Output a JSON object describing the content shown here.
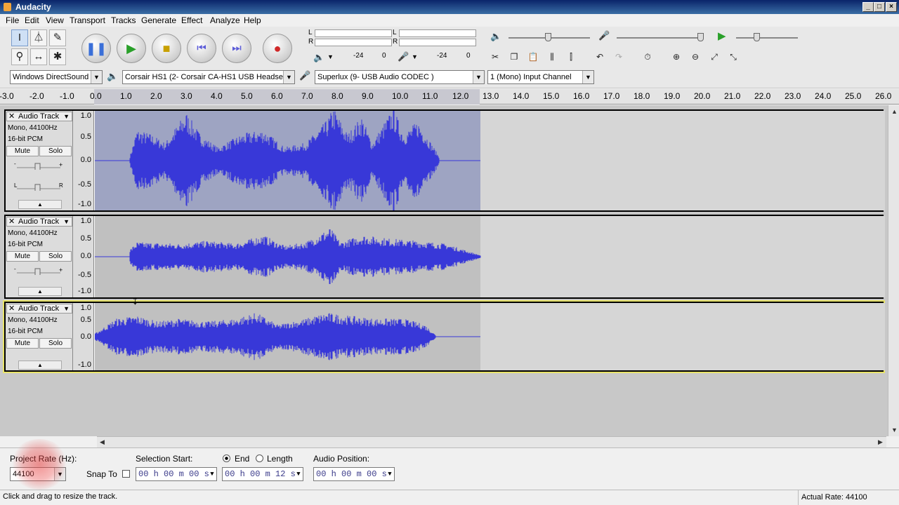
{
  "window": {
    "title": "Audacity"
  },
  "menu": [
    "File",
    "Edit",
    "View",
    "Transport",
    "Tracks",
    "Generate",
    "Effect",
    "Analyze",
    "Help"
  ],
  "meters": {
    "record_labels": [
      "-24",
      "0"
    ],
    "play_labels": [
      "-24",
      "0"
    ],
    "channel_l": "L",
    "channel_r": "R"
  },
  "devices": {
    "host": "Windows DirectSound",
    "playback": "Corsair HS1 (2- Corsair CA-HS1 USB Headset)",
    "recording": "Superlux (9- USB Audio CODEC )",
    "channels": "1 (Mono) Input Channel"
  },
  "ruler": {
    "ticks": [
      "-3.0",
      "-2.0",
      "-1.0",
      "0.0",
      "1.0",
      "2.0",
      "3.0",
      "4.0",
      "5.0",
      "6.0",
      "7.0",
      "8.0",
      "9.0",
      "10.0",
      "11.0",
      "12.0",
      "13.0",
      "14.0",
      "15.0",
      "16.0",
      "17.0",
      "18.0",
      "19.0",
      "20.0",
      "21.0",
      "22.0",
      "23.0",
      "24.0",
      "25.0",
      "26.0"
    ]
  },
  "tracks": [
    {
      "name": "Audio Track",
      "format": "Mono, 44100Hz",
      "bits": "16-bit PCM",
      "mute": "Mute",
      "solo": "Solo",
      "scale": [
        "1.0",
        "0.5",
        "0.0",
        "-0.5",
        "-1.0"
      ],
      "selected": true
    },
    {
      "name": "Audio Track",
      "format": "Mono, 44100Hz",
      "bits": "16-bit PCM",
      "mute": "Mute",
      "solo": "Solo",
      "scale": [
        "1.0",
        "0.5",
        "0.0",
        "-0.5",
        "-1.0"
      ],
      "selected": false
    },
    {
      "name": "Audio Track",
      "format": "Mono, 44100Hz",
      "bits": "16-bit PCM",
      "mute": "Mute",
      "solo": "Solo",
      "scale": [
        "1.0",
        "0.5",
        "0.0",
        "-1.0"
      ],
      "selected": false
    }
  ],
  "selection_bar": {
    "project_rate_label": "Project Rate (Hz):",
    "project_rate": "44100",
    "snap_to": "Snap To",
    "selection_start_label": "Selection Start:",
    "end_label": "End",
    "length_label": "Length",
    "audio_position_label": "Audio Position:",
    "start_value": "00 h 00 m 00 s",
    "end_value": "00 h 00 m 12 s",
    "position_value": "00 h 00 m 00 s"
  },
  "status": {
    "message": "Click and drag to resize the track.",
    "actual_rate": "Actual Rate: 44100"
  },
  "colors": {
    "wave": "#3838d8",
    "selection": "#9ea4c2",
    "track_bg": "#c0c0c0",
    "focus": "#e8e36a"
  }
}
